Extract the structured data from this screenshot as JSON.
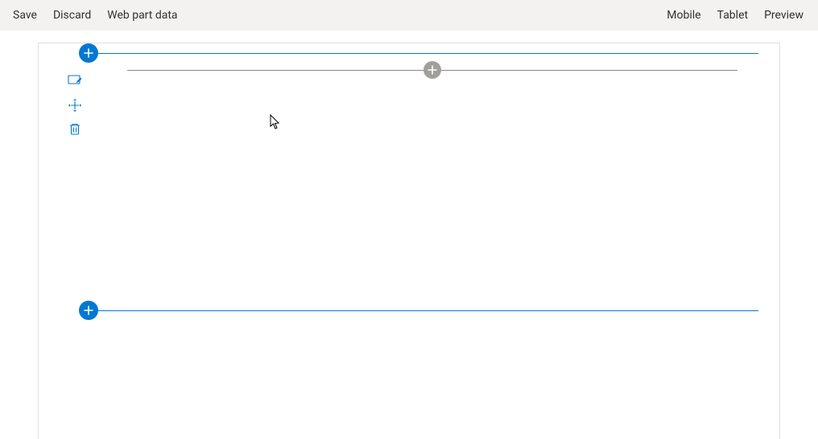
{
  "topbar": {
    "left": [
      {
        "id": "save",
        "label": "Save"
      },
      {
        "id": "discard",
        "label": "Discard"
      },
      {
        "id": "webpart-data",
        "label": "Web part data"
      }
    ],
    "right": [
      {
        "id": "mobile",
        "label": "Mobile"
      },
      {
        "id": "tablet",
        "label": "Tablet"
      },
      {
        "id": "preview",
        "label": "Preview"
      }
    ]
  },
  "colors": {
    "brand": "#0078d4",
    "toolbar_bg": "#f3f2f1",
    "canvas_border": "#e1dfdd",
    "muted_line": "#8a8886",
    "gray_plus_bg": "#a19f9d"
  }
}
